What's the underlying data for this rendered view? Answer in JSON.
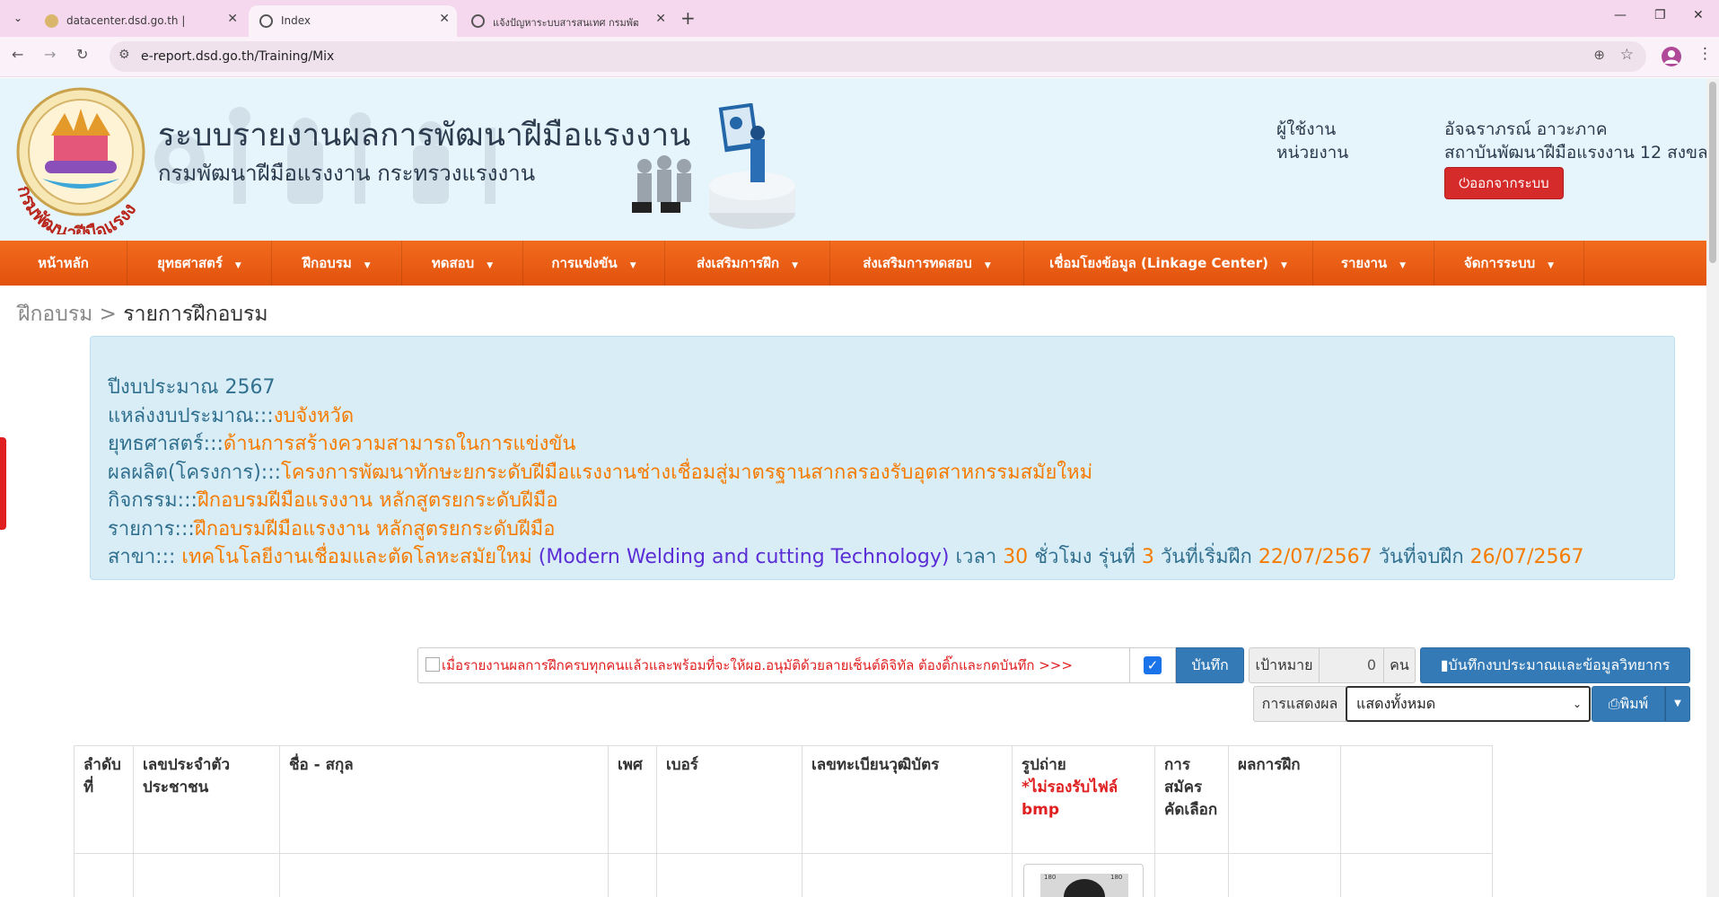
{
  "browser": {
    "tabs": [
      {
        "title": "datacenter.dsd.go.th |"
      },
      {
        "title": "Index"
      },
      {
        "title": "แจ้งปัญหาระบบสารสนเทศ กรมพัฒนา"
      }
    ],
    "url": "e-report.dsd.go.th/Training/Mix",
    "profile_initial": "●"
  },
  "header": {
    "title": "ระบบรายงานผลการพัฒนาฝีมือแรงงาน",
    "subtitle": "กรมพัฒนาฝีมือแรงงาน กระทรวงแรงงาน",
    "logo_text": "กรมพัฒนาฝีมือแรงงาน",
    "user_label": "ผู้ใช้งาน",
    "unit_label": "หน่วยงาน",
    "user_name": "อัจฉราภรณ์ อาวะภาค",
    "unit_name": "สถาบันพัฒนาฝีมือแรงงาน 12 สงขลา",
    "logout_label": "ออกจากระบบ"
  },
  "menu": [
    {
      "label": "หน้าหลัก",
      "dropdown": false
    },
    {
      "label": "ยุทธศาสตร์",
      "dropdown": true
    },
    {
      "label": "ฝึกอบรม",
      "dropdown": true
    },
    {
      "label": "ทดสอบ",
      "dropdown": true
    },
    {
      "label": "การแข่งขัน",
      "dropdown": true
    },
    {
      "label": "ส่งเสริมการฝึก",
      "dropdown": true
    },
    {
      "label": "ส่งเสริมการทดสอบ",
      "dropdown": true
    },
    {
      "label": "เชื่อมโยงข้อมูล (Linkage Center)",
      "dropdown": true
    },
    {
      "label": "รายงาน",
      "dropdown": true
    },
    {
      "label": "จัดการระบบ",
      "dropdown": true
    }
  ],
  "breadcrumb": {
    "parent": "ฝึกอบรม",
    "separator": ">",
    "current": "รายการฝึกอบรม"
  },
  "info": {
    "fiscal_year": "ปีงบประมาณ 2567",
    "budget_source_label": "แหล่งงบประมาณ:::",
    "budget_source": "งบจังหวัด",
    "strategy_label": "ยุทธศาสตร์:::",
    "strategy": "ด้านการสร้างความสามารถในการแข่งขัน",
    "output_label": "ผลผลิต(โครงการ):::",
    "output": "โครงการพัฒนาทักษะยกระดับฝีมือแรงงานช่างเชื่อมสู่มาตรฐานสากลรองรับอุตสาหกรรมสมัยใหม่",
    "activity_label": "กิจกรรม:::",
    "activity": "ฝึกอบรมฝีมือแรงงาน หลักสูตรยกระดับฝีมือ",
    "item_label": "รายการ:::",
    "item": "ฝึกอบรมฝีมือแรงงาน หลักสูตรยกระดับฝีมือ",
    "branch_label": "สาขา:::",
    "branch_th": "เทคโนโลยีงานเชื่อมและตัดโลหะสมัยใหม่",
    "branch_en": "(Modern Welding and cutting Technology)",
    "hours_label": "เวลา",
    "hours": "30",
    "hours_unit": "ชั่วโมง",
    "batch_label": "รุ่นที่",
    "batch": "3",
    "start_label": "วันที่เริ่มฝึก",
    "start_date": "22/07/2567",
    "end_label": "วันที่จบฝึก",
    "end_date": "26/07/2567"
  },
  "actions": {
    "notice": "เมื่อรายงานผลการฝึกครบทุกคนแล้วและพร้อมที่จะให้ผอ.อนุมัติด้วยลายเซ็นต์ดิจิทัล ต้องติ๊กและกดบันทึก >>>",
    "checked": true,
    "save_label": "บันทึก",
    "target_label": "เป้าหมาย",
    "target_value": "0",
    "target_unit": "คน",
    "budget_button": "บันทึกงบประมาณและข้อมูลวิทยากร",
    "display_label": "การแสดงผล",
    "display_selected": "แสดงทั้งหมด",
    "print_label": "พิมพ์"
  },
  "table": {
    "headers": [
      {
        "text": "ลำดับที่"
      },
      {
        "text": "เลขประจำตัวประชาชน"
      },
      {
        "text": "ชื่อ - สกุล"
      },
      {
        "text": "เพศ"
      },
      {
        "text": "เบอร์"
      },
      {
        "text": "เลขทะเบียนวุฒิบัตร"
      },
      {
        "text": "รูปถ่าย",
        "note": "*ไม่รองรับไฟล์ bmp"
      },
      {
        "text": "การสมัครคัดเลือก"
      },
      {
        "text": "ผลการฝึก"
      },
      {
        "text": ""
      }
    ],
    "photo_label_left": "180",
    "photo_label_right": "180"
  }
}
